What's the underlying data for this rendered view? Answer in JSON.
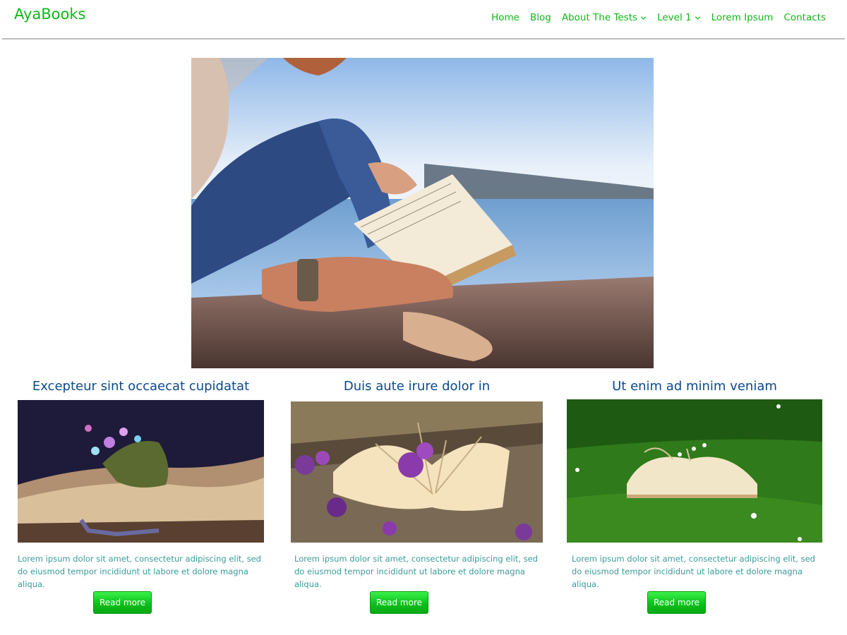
{
  "site": {
    "logo": "AyaBooks"
  },
  "nav": {
    "items": [
      {
        "label": "Home",
        "dropdown": false
      },
      {
        "label": "Blog",
        "dropdown": false
      },
      {
        "label": "About The Tests",
        "dropdown": true
      },
      {
        "label": "Level 1",
        "dropdown": true
      },
      {
        "label": "Lorem Ipsum",
        "dropdown": false
      },
      {
        "label": "Contacts",
        "dropdown": false
      }
    ]
  },
  "colors": {
    "accent": "#11b718",
    "title": "#0a4a8c",
    "body_text": "#3a9a9a"
  },
  "cards": [
    {
      "title": "Excepteur sint occaecat cupidatat",
      "text": "Lorem ipsum dolor sit amet, consectetur adipiscing elit, sed do eiusmod tempor incididunt ut labore et dolore magna aliqua.",
      "button": "Read more"
    },
    {
      "title": "Duis aute irure dolor in",
      "text": "Lorem ipsum dolor sit amet, consectetur adipiscing elit, sed do eiusmod tempor incididunt ut labore et dolore magna aliqua.",
      "button": "Read more"
    },
    {
      "title": "Ut enim ad minim veniam",
      "text": "Lorem ipsum dolor sit amet, consectetur adipiscing elit, sed do eiusmod tempor incididunt ut labore et dolore magna aliqua.",
      "button": "Read more"
    }
  ]
}
